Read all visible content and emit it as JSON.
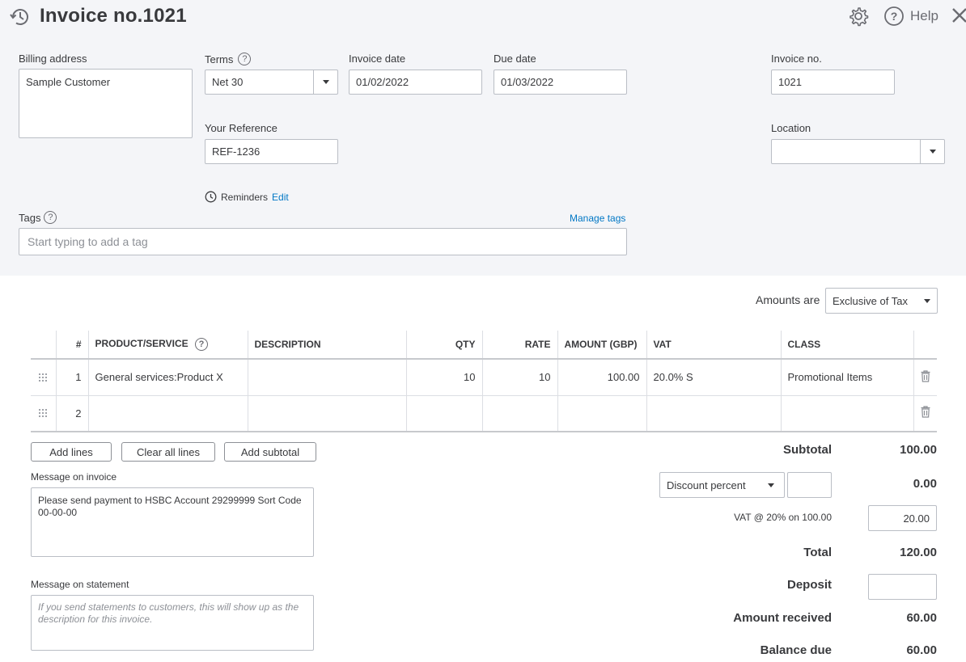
{
  "header": {
    "title": "Invoice no.1021",
    "help_label": "Help"
  },
  "form": {
    "billing_address_label": "Billing address",
    "billing_address_value": "Sample Customer",
    "terms_label": "Terms",
    "terms_value": "Net 30",
    "invoice_date_label": "Invoice date",
    "invoice_date_value": "01/02/2022",
    "due_date_label": "Due date",
    "due_date_value": "01/03/2022",
    "invoice_no_label": "Invoice no.",
    "invoice_no_value": "1021",
    "your_reference_label": "Your Reference",
    "your_reference_value": "REF-1236",
    "location_label": "Location",
    "location_value": "",
    "reminders_label": "Reminders",
    "reminders_edit": "Edit",
    "tags_label": "Tags",
    "manage_tags": "Manage tags",
    "tags_placeholder": "Start typing to add a tag"
  },
  "amounts": {
    "label": "Amounts are",
    "value": "Exclusive of Tax"
  },
  "table": {
    "headers": [
      "#",
      "PRODUCT/SERVICE",
      "DESCRIPTION",
      "QTY",
      "RATE",
      "AMOUNT (GBP)",
      "VAT",
      "CLASS"
    ],
    "rows": [
      {
        "num": "1",
        "product": "General services:Product X",
        "description": "",
        "qty": "10",
        "rate": "10",
        "amount": "100.00",
        "vat": "20.0% S",
        "class": "Promotional Items"
      },
      {
        "num": "2",
        "product": "",
        "description": "",
        "qty": "",
        "rate": "",
        "amount": "",
        "vat": "",
        "class": ""
      }
    ]
  },
  "buttons": {
    "add_lines": "Add lines",
    "clear_all_lines": "Clear all lines",
    "add_subtotal": "Add subtotal"
  },
  "messages": {
    "invoice_label": "Message on invoice",
    "invoice_value": "Please send payment to HSBC Account 29299999 Sort Code 00-00-00",
    "statement_label": "Message on statement",
    "statement_placeholder": "If you send statements to customers, this will show up as the description for this invoice."
  },
  "totals": {
    "subtotal_label": "Subtotal",
    "subtotal_value": "100.00",
    "discount_type": "Discount percent",
    "discount_input": "",
    "discount_value": "0.00",
    "vat_label": "VAT @ 20% on 100.00",
    "vat_value": "20.00",
    "total_label": "Total",
    "total_value": "120.00",
    "deposit_label": "Deposit",
    "deposit_value": "",
    "amount_received_label": "Amount received",
    "amount_received_value": "60.00",
    "balance_due_label": "Balance due",
    "balance_due_value": "60.00"
  },
  "icons": {
    "title": "recent-transactions-icon",
    "settings": "gear-icon",
    "help": "help-icon",
    "close": "close-icon",
    "reminders": "clock-icon",
    "delete": "trash-icon",
    "drag": "drag-handle-icon"
  },
  "colors": {
    "link": "#0077c5",
    "header_bg": "#f4f5f8",
    "text": "#393a3d"
  }
}
